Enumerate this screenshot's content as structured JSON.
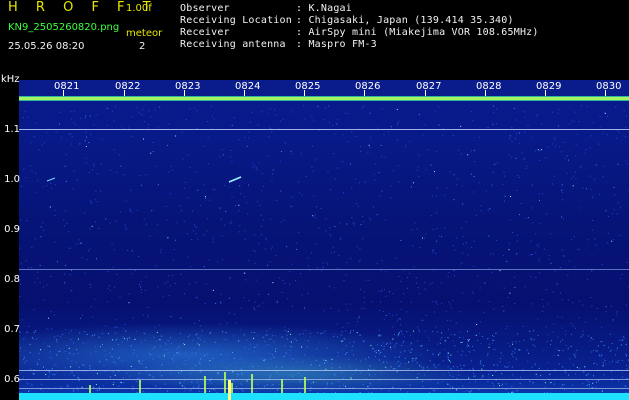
{
  "header": {
    "app_title": "H R O F F T",
    "version": "1.00f",
    "filename": "KN9_2505260820.png",
    "meteor_label": "meteor",
    "datetime": "25.05.26 08:20",
    "meteor_count": "2",
    "info": [
      {
        "label": "Observer",
        "value": ": K.Nagai"
      },
      {
        "label": "Receiving Location",
        "value": ": Chigasaki, Japan (139.414 35.340)"
      },
      {
        "label": "Receiver",
        "value": ": AirSpy mini (Miakejima VOR 108.65MHz)"
      },
      {
        "label": "Receiving antenna",
        "value": ": Maspro FM-3"
      }
    ]
  },
  "y_axis": {
    "unit": "kHz",
    "ticks": [
      "1.1",
      "1.0",
      "0.9",
      "0.8",
      "0.7",
      "0.6"
    ]
  },
  "x_axis": {
    "ticks": [
      "0821",
      "0822",
      "0823",
      "0824",
      "0825",
      "0826",
      "0827",
      "0828",
      "0829",
      "0830"
    ]
  },
  "colors": {
    "background": "#000000",
    "spectrum_low": "#061070",
    "carrier": "#c8ff50",
    "title": "#e8e800",
    "filename": "#3cff3c"
  }
}
